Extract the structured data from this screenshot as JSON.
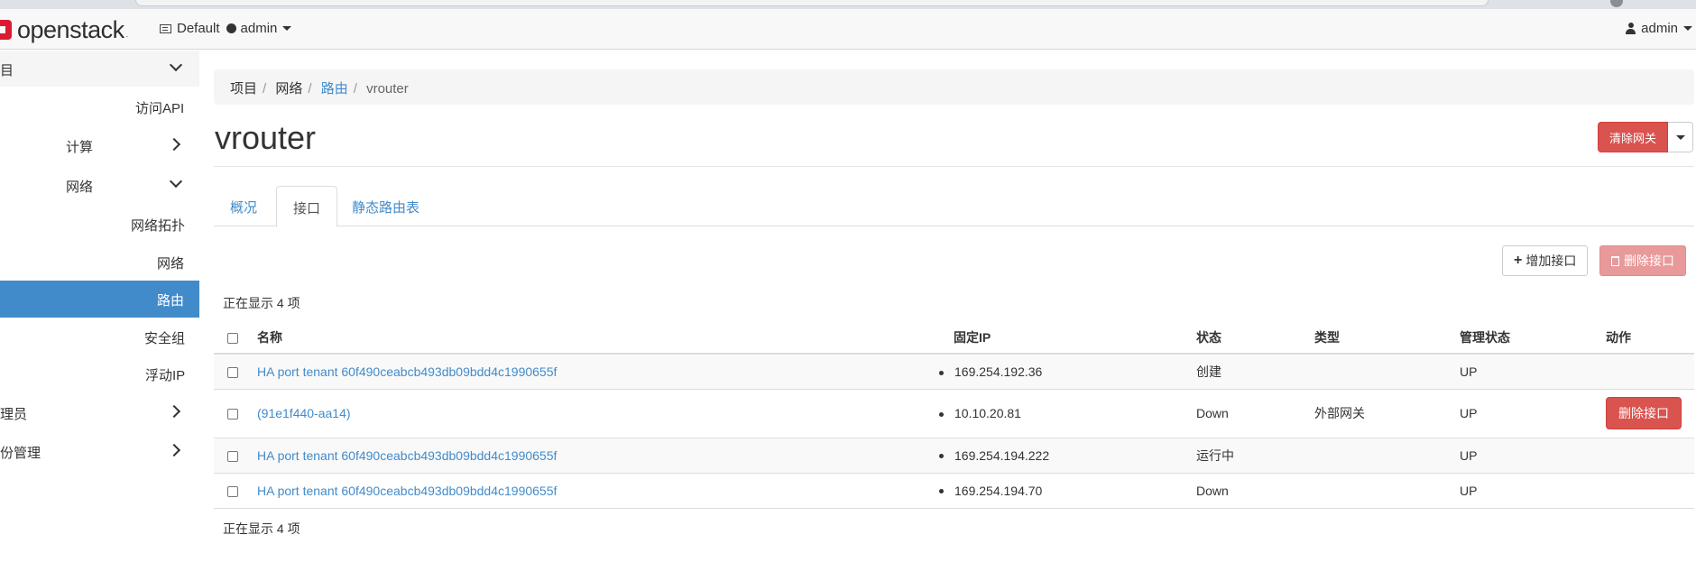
{
  "brand": {
    "name": "openstack",
    "mark": "."
  },
  "topbar": {
    "domain": "Default",
    "project": "admin",
    "user": "admin"
  },
  "sidebar": {
    "items": [
      {
        "label": "项目"
      },
      {
        "label": "访问API"
      },
      {
        "label": "计算"
      },
      {
        "label": "网络"
      },
      {
        "label": "网络拓扑"
      },
      {
        "label": "网络"
      },
      {
        "label": "路由"
      },
      {
        "label": "安全组"
      },
      {
        "label": "浮动IP"
      },
      {
        "label": "管理员"
      },
      {
        "label": "身份管理"
      }
    ]
  },
  "breadcrumb": [
    "项目",
    "网络",
    "路由",
    "vrouter"
  ],
  "page": {
    "title": "vrouter",
    "clear_gateway": "清除网关"
  },
  "tabs": [
    "概况",
    "接口",
    "静态路由表"
  ],
  "actions": {
    "add_interface": "增加接口",
    "delete_interfaces": "删除接口"
  },
  "table": {
    "count_text": "正在显示 4 项",
    "columns": [
      "名称",
      "固定IP",
      "状态",
      "类型",
      "管理状态",
      "动作"
    ],
    "rows": [
      {
        "name": "HA port tenant 60f490ceabcb493db09bdd4c1990655f",
        "ip": "169.254.192.36",
        "status": "创建",
        "type": "",
        "admin": "UP",
        "action": ""
      },
      {
        "name": "(91e1f440-aa14)",
        "ip": "10.10.20.81",
        "status": "Down",
        "type": "外部网关",
        "admin": "UP",
        "action": "删除接口"
      },
      {
        "name": "HA port tenant 60f490ceabcb493db09bdd4c1990655f",
        "ip": "169.254.194.222",
        "status": "运行中",
        "type": "",
        "admin": "UP",
        "action": ""
      },
      {
        "name": "HA port tenant 60f490ceabcb493db09bdd4c1990655f",
        "ip": "169.254.194.70",
        "status": "Down",
        "type": "",
        "admin": "UP",
        "action": ""
      }
    ]
  },
  "colors": {
    "primary": "#428bca",
    "danger": "#d9534f"
  }
}
